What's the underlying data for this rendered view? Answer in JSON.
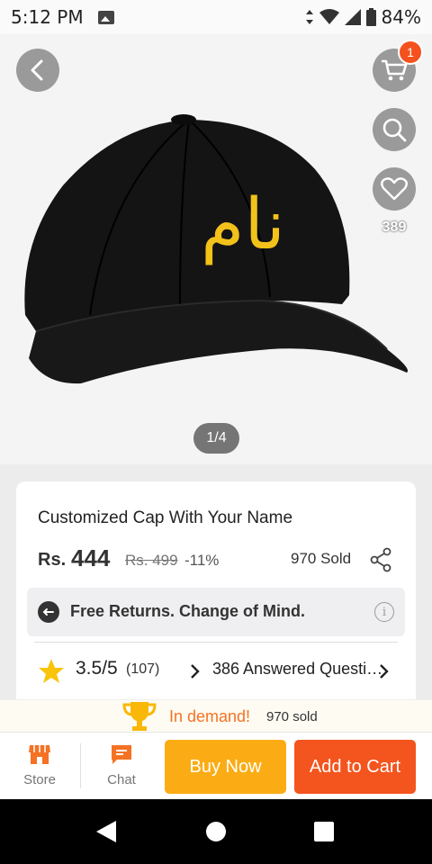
{
  "status_bar": {
    "time": "5:12 PM",
    "battery": "84%"
  },
  "gallery": {
    "cart_count": "1",
    "wishlist_count": "389",
    "image_counter": "1/4",
    "product_image_text": "نام"
  },
  "product": {
    "title": "Customized Cap With Your Name",
    "currency": "Rs.",
    "price": "444",
    "original_price": "Rs. 499",
    "discount": "-11%",
    "sold": "970 Sold"
  },
  "returns": {
    "label": "Free Returns. Change of Mind."
  },
  "rating": {
    "value": "3.5/5",
    "count": "(107)",
    "answered": "386  Answered Questions"
  },
  "demand": {
    "label": "In demand!",
    "sold": "970 sold"
  },
  "bottom_bar": {
    "store_label": "Store",
    "chat_label": "Chat",
    "buy_now_label": "Buy Now",
    "add_to_cart_label": "Add to Cart"
  },
  "colors": {
    "accent_orange": "#f57224",
    "buy_now": "#fbac14",
    "add_to_cart": "#f4541e",
    "star": "#f9c40b"
  }
}
